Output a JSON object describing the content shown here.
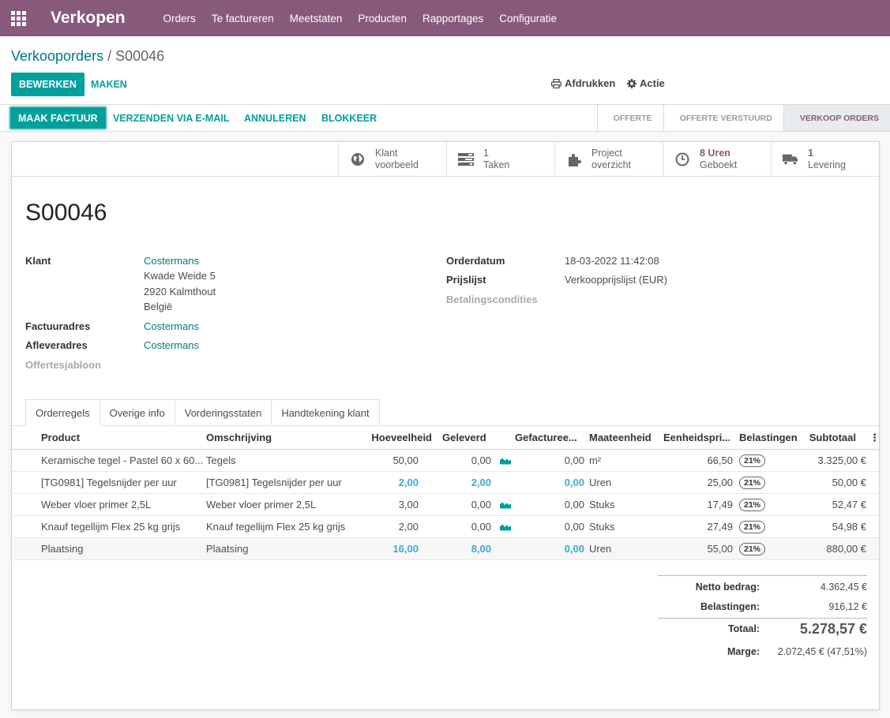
{
  "app": {
    "name": "Verkopen",
    "menu": [
      "Orders",
      "Te factureren",
      "Meetstaten",
      "Producten",
      "Rapportages",
      "Configuratie"
    ]
  },
  "breadcrumb": {
    "parent": "Verkooporders",
    "separator": "/",
    "current": "S00046"
  },
  "control": {
    "edit_label": "BEWERKEN",
    "create_label": "MAKEN",
    "print_label": "Afdrukken",
    "action_label": "Actie"
  },
  "statusbar": {
    "buttons": [
      "MAAK FACTUUR",
      "VERZENDEN VIA E-MAIL",
      "ANNULEREN",
      "BLOKKEER"
    ],
    "stages": [
      "OFFERTE",
      "OFFERTE VERSTUURD",
      "VERKOOP ORDERS"
    ],
    "active_stage": "VERKOOP ORDERS"
  },
  "smart_buttons": [
    {
      "icon": "globe-icon",
      "line1": "Klant",
      "line2": "voorbeeld"
    },
    {
      "icon": "tasks-icon",
      "line1": "1",
      "line2": "Taken"
    },
    {
      "icon": "puzzle-icon",
      "line1": "Project",
      "line2": "overzicht"
    },
    {
      "icon": "clock-icon",
      "line1": "8 Uren",
      "line2": "Geboekt"
    },
    {
      "icon": "truck-icon",
      "line1": "1",
      "line2": "Levering"
    }
  ],
  "order": {
    "name": "S00046",
    "klant_label": "Klant",
    "klant_name": "Costermans",
    "address": [
      "Kwade Weide 5",
      "2920 Kalmthout",
      "België"
    ],
    "invoice_label": "Factuuradres",
    "invoice_value": "Costermans",
    "delivery_label": "Afleveradres",
    "delivery_value": "Costermans",
    "template_label": "Offertesjabloon",
    "date_label": "Orderdatum",
    "date_value": "18-03-2022 11:42:08",
    "pricelist_label": "Prijslijst",
    "pricelist_value": "Verkoopprijslijst (EUR)",
    "payment_label": "Betalingscondities"
  },
  "tabs": [
    "Orderregels",
    "Overige info",
    "Vorderingsstaten",
    "Handtekening klant"
  ],
  "lines": {
    "headers": [
      "Product",
      "Omschrijving",
      "Hoeveelheid",
      "Geleverd",
      "Gefacturee...",
      "Maateenheid",
      "Eenheidspri...",
      "Belastingen",
      "Subtotaal"
    ],
    "rows": [
      {
        "product": "Keramische tegel - Pastel 60 x 60...",
        "desc": "Tegels",
        "qty": "50,00",
        "delivered": "0,00",
        "invoiced": "0,00",
        "uom": "m²",
        "price": "66,50",
        "tax": "21%",
        "subtotal": "3.325,00 €",
        "service": false
      },
      {
        "product": "[TG0981] Tegelsnijder per uur",
        "desc": "[TG0981] Tegelsnijder per uur",
        "qty": "2,00",
        "delivered": "2,00",
        "invoiced": "0,00",
        "uom": "Uren",
        "price": "25,00",
        "tax": "21%",
        "subtotal": "50,00 €",
        "service": true
      },
      {
        "product": "Weber vloer primer 2,5L",
        "desc": "Weber vloer primer 2,5L",
        "qty": "3,00",
        "delivered": "0,00",
        "invoiced": "0,00",
        "uom": "Stuks",
        "price": "17,49",
        "tax": "21%",
        "subtotal": "52,47 €",
        "service": false
      },
      {
        "product": "Knauf tegellijm Flex 25 kg grijs",
        "desc": "Knauf tegellijm Flex 25 kg grijs",
        "qty": "2,00",
        "delivered": "0,00",
        "invoiced": "0,00",
        "uom": "Stuks",
        "price": "27,49",
        "tax": "21%",
        "subtotal": "54,98 €",
        "service": false
      },
      {
        "product": "Plaatsing",
        "desc": "Plaatsing",
        "qty": "16,00",
        "delivered": "8,00",
        "invoiced": "0,00",
        "uom": "Uren",
        "price": "55,00",
        "tax": "21%",
        "subtotal": "880,00 €",
        "service": true
      }
    ]
  },
  "totals": {
    "net_label": "Netto bedrag:",
    "net_value": "4.362,45 €",
    "tax_label": "Belastingen:",
    "tax_value": "916,12 €",
    "total_label": "Totaal:",
    "total_value": "5.278,57 €",
    "margin_label": "Marge:",
    "margin_value": "2.072,45 € (47,51%)"
  },
  "colors": {
    "brand": "#875a7b",
    "primary": "#00a09d",
    "link": "#01797e",
    "service_blue": "#3fa9d1"
  }
}
